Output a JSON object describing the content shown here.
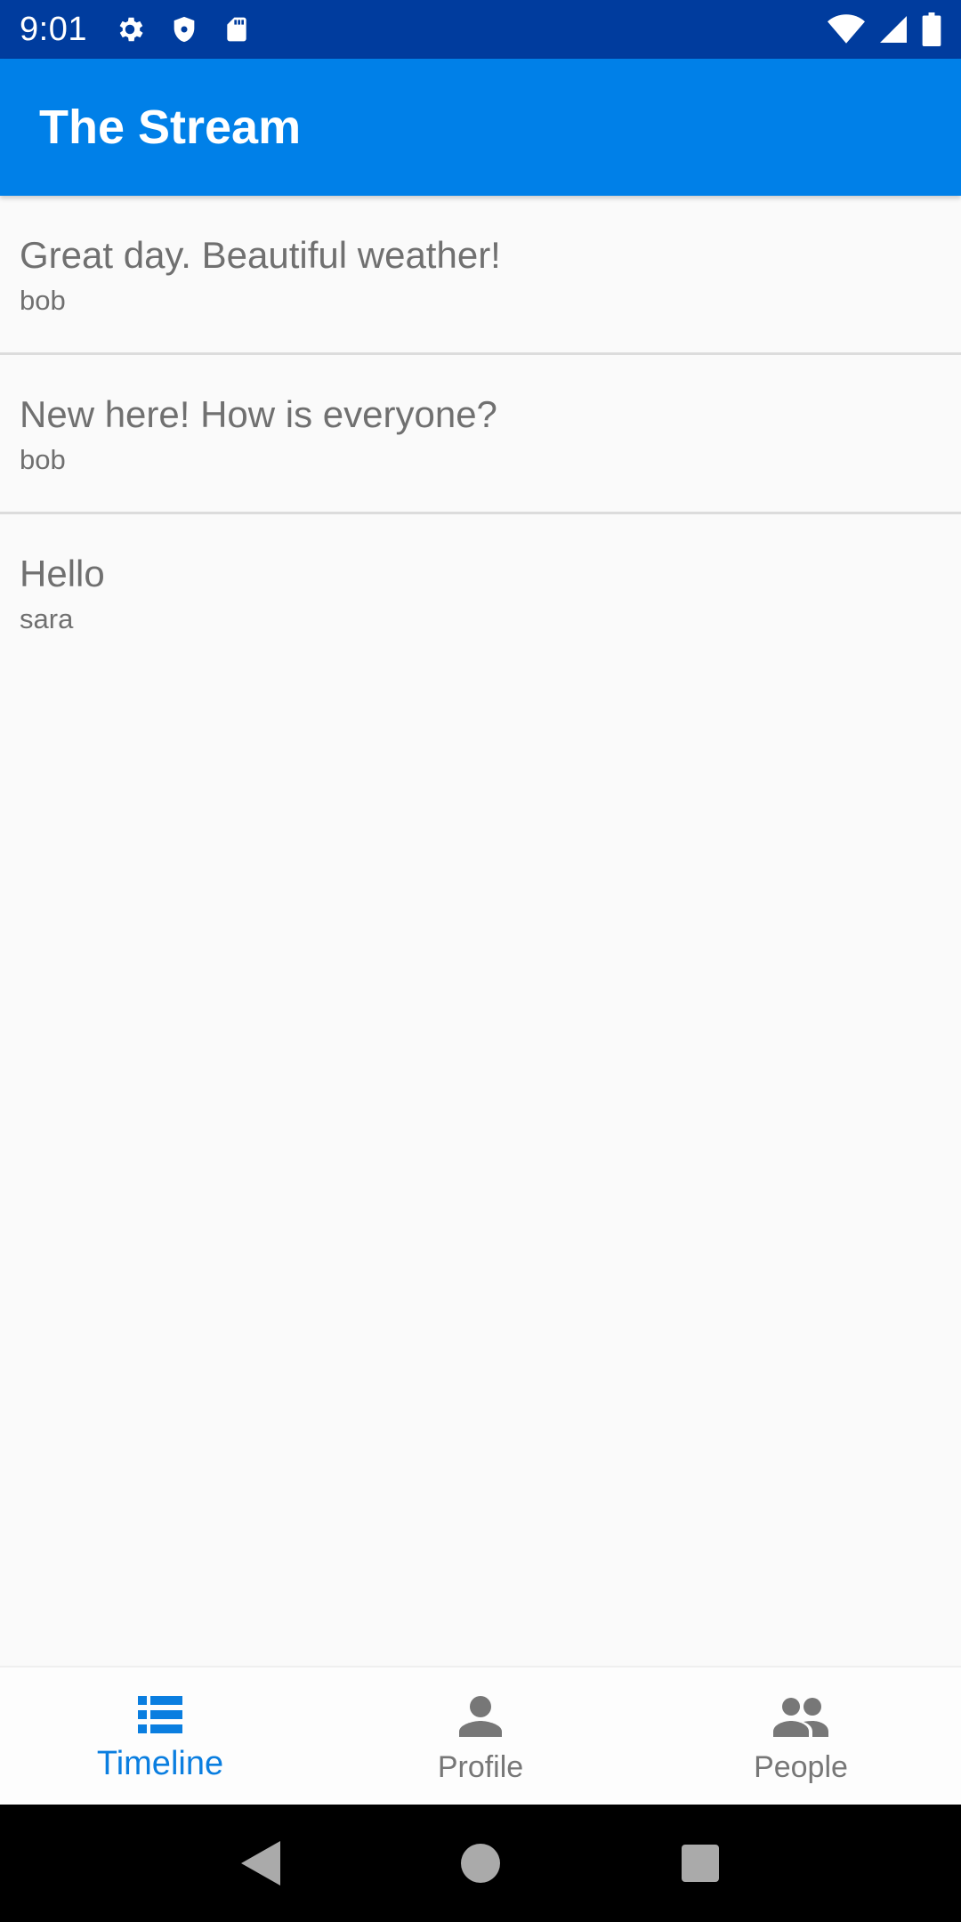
{
  "status_bar": {
    "time": "9:01",
    "icons_left": [
      "gear-icon",
      "shield-icon",
      "sd-card-icon"
    ],
    "icons_right": [
      "wifi-icon",
      "signal-icon",
      "battery-icon"
    ]
  },
  "app_bar": {
    "title": "The Stream",
    "color": "#0080e8"
  },
  "posts": [
    {
      "text": "Great day. Beautiful weather!",
      "author": "bob"
    },
    {
      "text": "New here! How is everyone?",
      "author": "bob"
    },
    {
      "text": "Hello",
      "author": "sara"
    }
  ],
  "bottom_nav": {
    "items": [
      {
        "label": "Timeline",
        "icon": "timeline-list-icon",
        "active": true
      },
      {
        "label": "Profile",
        "icon": "person-icon",
        "active": false
      },
      {
        "label": "People",
        "icon": "people-icon",
        "active": false
      }
    ],
    "active_color": "#0a7ee0",
    "inactive_color": "#777777"
  },
  "system_nav": {
    "icons": [
      "back-icon",
      "home-icon",
      "recents-icon"
    ]
  }
}
